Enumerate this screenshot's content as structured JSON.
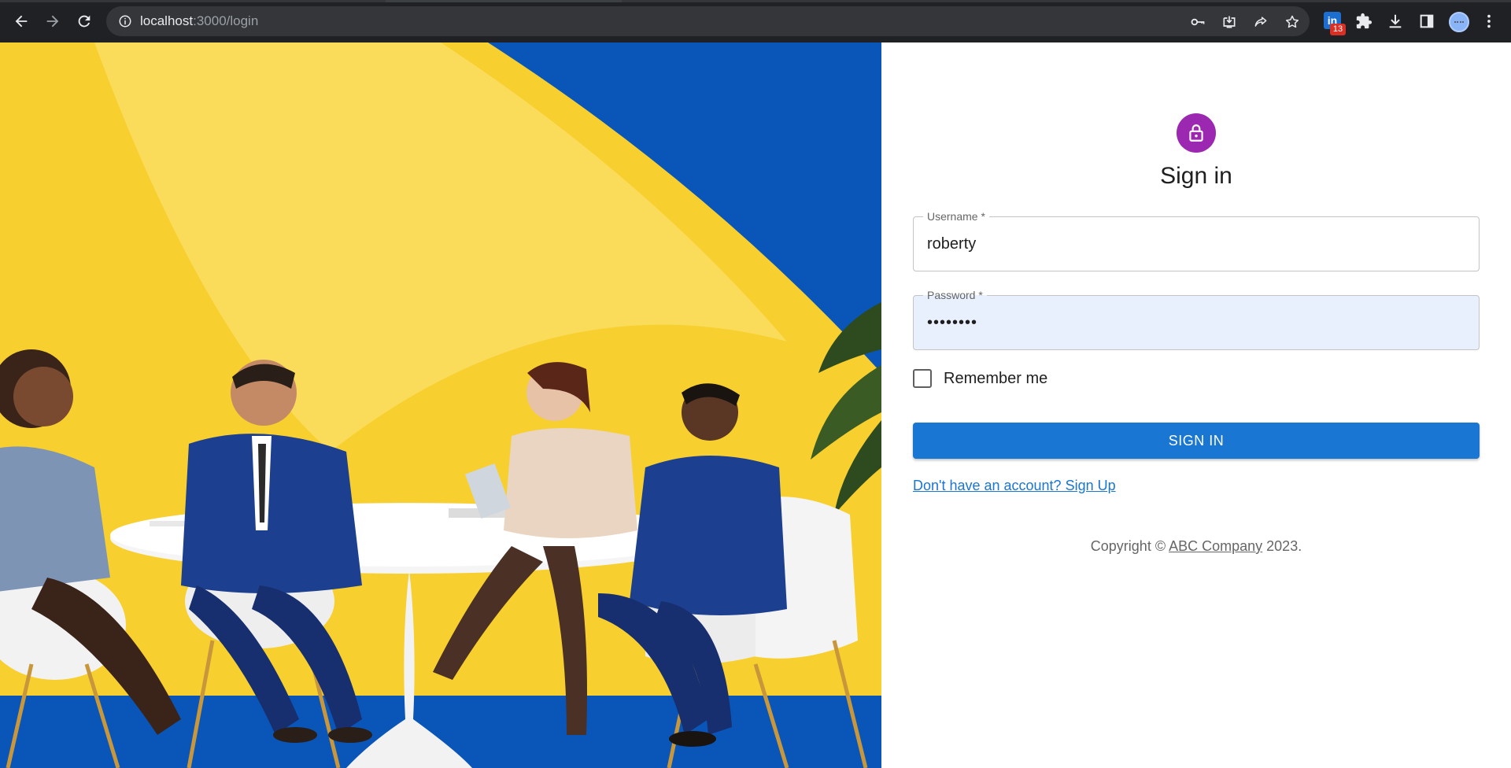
{
  "browser": {
    "url_host": "localhost",
    "url_rest": ":3000/login",
    "extension_badge": "13",
    "extension_letter": "in"
  },
  "form": {
    "title": "Sign in",
    "username": {
      "label": "Username *",
      "value": "roberty"
    },
    "password": {
      "label": "Password *",
      "value": "••••••••"
    },
    "remember_label": "Remember me",
    "submit_label": "SIGN IN",
    "signup_link": "Don't have an account? Sign Up"
  },
  "footer": {
    "prefix": "Copyright © ",
    "company": "ABC Company",
    "suffix": " 2023."
  },
  "colors": {
    "brand_button": "#1976d2",
    "lock_avatar": "#9c27b0",
    "autofill_bg": "#e8f0fe"
  }
}
